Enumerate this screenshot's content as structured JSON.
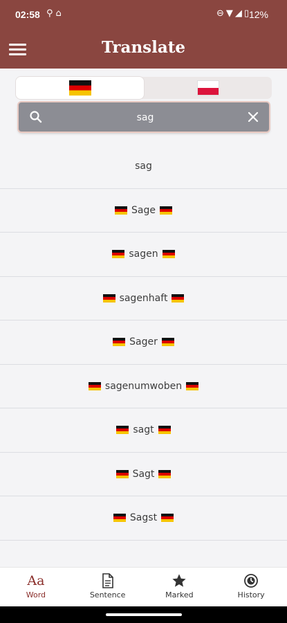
{
  "status_bar": {
    "time": "02:58",
    "battery": "12%",
    "icons": [
      "usb-icon",
      "cleaner-icon",
      "dnd-icon",
      "wifi-icon",
      "signal-icon",
      "battery-icon"
    ]
  },
  "app_bar": {
    "title": "Translate",
    "menu_icon": "hamburger-icon"
  },
  "language_toggle": {
    "source_flag": "germany-flag",
    "target_flag": "poland-flag",
    "selected": "source"
  },
  "search": {
    "value": "sag",
    "search_icon": "search-icon",
    "clear_icon": "close-icon"
  },
  "results": [
    {
      "word": "sag",
      "flags": false
    },
    {
      "word": "Sage",
      "flags": true
    },
    {
      "word": "sagen",
      "flags": true
    },
    {
      "word": "sagenhaft",
      "flags": true
    },
    {
      "word": "Sager",
      "flags": true
    },
    {
      "word": "sagenumwoben",
      "flags": true
    },
    {
      "word": "sagt",
      "flags": true
    },
    {
      "word": "Sagt",
      "flags": true
    },
    {
      "word": "Sagst",
      "flags": true
    }
  ],
  "bottom_nav": [
    {
      "label": "Word",
      "icon": "word-aa-icon",
      "active": true
    },
    {
      "label": "Sentence",
      "icon": "document-icon",
      "active": false
    },
    {
      "label": "Marked",
      "icon": "star-icon",
      "active": false
    },
    {
      "label": "History",
      "icon": "history-icon",
      "active": false
    }
  ],
  "colors": {
    "app_bar": "#8a4640",
    "accent": "#8a2e2a",
    "search_bg": "#8c8d94",
    "background": "#f4f4f6"
  }
}
